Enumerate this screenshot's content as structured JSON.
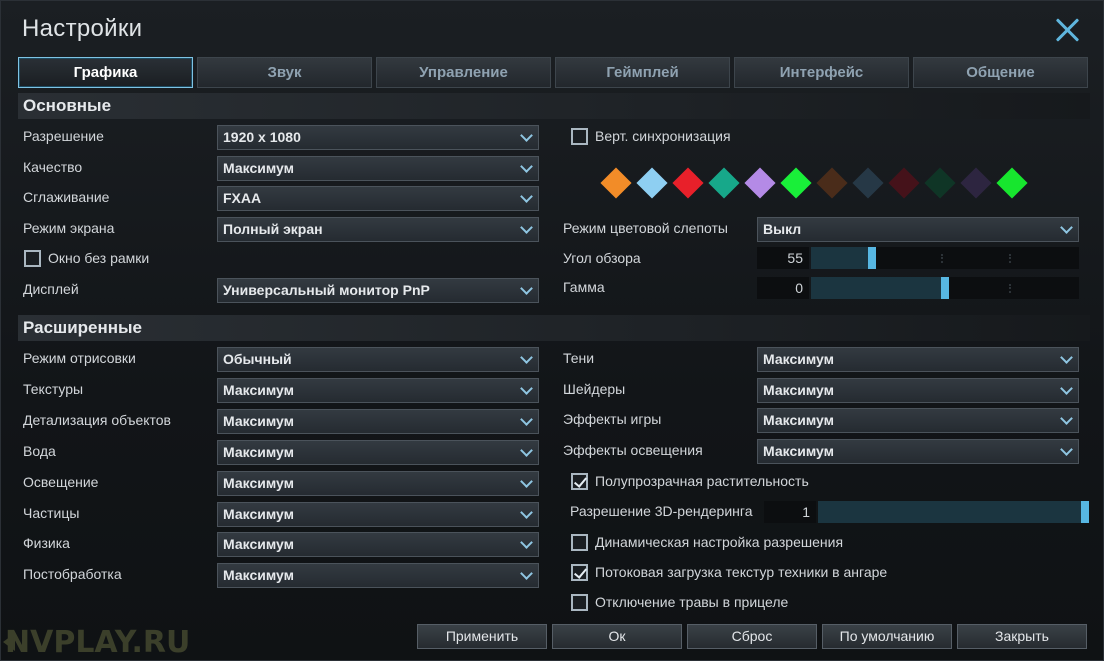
{
  "window": {
    "title": "Настройки"
  },
  "tabs": [
    {
      "label": "Графика",
      "active": true
    },
    {
      "label": "Звук"
    },
    {
      "label": "Управление"
    },
    {
      "label": "Геймплей"
    },
    {
      "label": "Интерфейс"
    },
    {
      "label": "Общение"
    }
  ],
  "basic": {
    "header": "Основные",
    "resolution": {
      "label": "Разрешение",
      "value": "1920 x 1080"
    },
    "quality": {
      "label": "Качество",
      "value": "Максимум"
    },
    "antialiasing": {
      "label": "Сглаживание",
      "value": "FXAA"
    },
    "screen_mode": {
      "label": "Режим экрана",
      "value": "Полный экран"
    },
    "borderless": {
      "label": "Окно без рамки",
      "checked": false
    },
    "display": {
      "label": "Дисплей",
      "value": "Универсальный монитор PnP"
    },
    "vsync": {
      "label": "Верт. синхронизация",
      "checked": false
    },
    "color_swatches": [
      "#f28c28",
      "#8ecff2",
      "#e8202a",
      "#17a88a",
      "#b48ae6",
      "#19ef39",
      "#4a2c1a",
      "#263846",
      "#45121a",
      "#0f3526",
      "#2d2540",
      "#17e62e"
    ],
    "colorblind": {
      "label": "Режим цветовой слепоты",
      "value": "Выкл"
    },
    "fov": {
      "label": "Угол обзора",
      "value": "55",
      "fraction": 0.22
    },
    "gamma": {
      "label": "Гамма",
      "value": "0",
      "fraction": 0.5
    }
  },
  "advanced": {
    "header": "Расширенные",
    "left": [
      {
        "label": "Режим отрисовки",
        "value": "Обычный"
      },
      {
        "label": "Текстуры",
        "value": "Максимум"
      },
      {
        "label": "Детализация объектов",
        "value": "Максимум"
      },
      {
        "label": "Вода",
        "value": "Максимум"
      },
      {
        "label": "Освещение",
        "value": "Максимум"
      },
      {
        "label": "Частицы",
        "value": "Максимум"
      },
      {
        "label": "Физика",
        "value": "Максимум"
      },
      {
        "label": "Постобработка",
        "value": "Максимум"
      }
    ],
    "right": [
      {
        "label": "Тени",
        "value": "Максимум"
      },
      {
        "label": "Шейдеры",
        "value": "Максимум"
      },
      {
        "label": "Эффекты игры",
        "value": "Максимум"
      },
      {
        "label": "Эффекты освещения",
        "value": "Максимум"
      }
    ],
    "translucent_vegetation": {
      "label": "Полупрозрачная растительность",
      "checked": true
    },
    "render_resolution": {
      "label": "Разрешение 3D-рендеринга",
      "value": "1",
      "fraction": 1.0
    },
    "dynamic_resolution": {
      "label": "Динамическая настройка разрешения",
      "checked": false
    },
    "texture_streaming": {
      "label": "Потоковая загрузка текстур техники в ангаре",
      "checked": true
    },
    "disable_grass": {
      "label": "Отключение травы в прицеле",
      "checked": false
    }
  },
  "footer": {
    "apply": "Применить",
    "ok": "Ок",
    "reset": "Сброс",
    "defaults": "По умолчанию",
    "close": "Закрыть"
  },
  "watermark": "NVPLAY.RU"
}
